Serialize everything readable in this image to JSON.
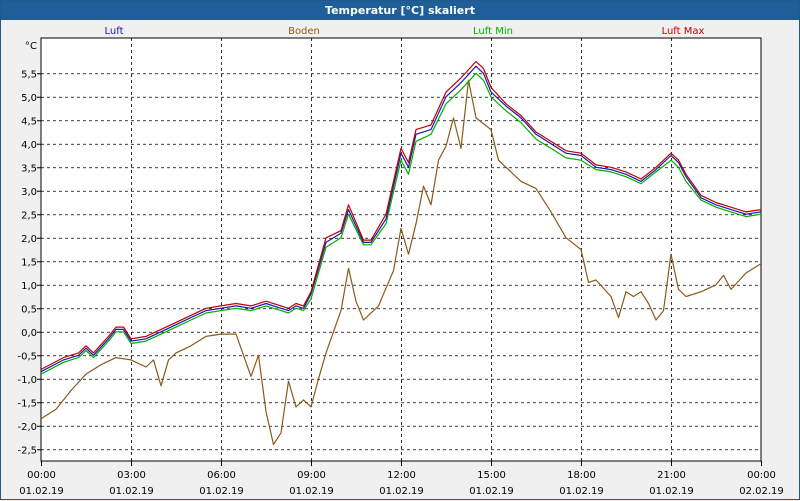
{
  "window": {
    "title": "Temperatur [°C] skaliert"
  },
  "colors": {
    "Luft": "#1a1ab5",
    "Boden": "#8b5a1a",
    "Luft Min": "#00b000",
    "Luft Max": "#c00000"
  },
  "chart_data": {
    "type": "line",
    "title": "Temperatur [°C] skaliert",
    "ylabel": "°C",
    "ylim": [
      -2.75,
      6.25
    ],
    "xlim": [
      "01.02.19 00:00",
      "02.02.19 00:00"
    ],
    "grid": true,
    "legend_placement": "top",
    "yticks": [
      "5,5",
      "5,0",
      "4,5",
      "4,0",
      "3,5",
      "3,0",
      "2,5",
      "2,0",
      "1,5",
      "1,0",
      "0,5",
      "0,0",
      "-0,5",
      "-1,0",
      "-1,5",
      "-2,0",
      "-2,5"
    ],
    "xticks": [
      {
        "time": "00:00",
        "date": "01.02.19"
      },
      {
        "time": "03:00",
        "date": "01.02.19"
      },
      {
        "time": "06:00",
        "date": "01.02.19"
      },
      {
        "time": "09:00",
        "date": "01.02.19"
      },
      {
        "time": "12:00",
        "date": "01.02.19"
      },
      {
        "time": "15:00",
        "date": "01.02.19"
      },
      {
        "time": "18:00",
        "date": "01.02.19"
      },
      {
        "time": "21:00",
        "date": "01.02.19"
      },
      {
        "time": "00:00",
        "date": "02.02.19"
      }
    ],
    "series": [
      {
        "name": "Luft",
        "points": [
          [
            "00:00",
            -0.85
          ],
          [
            "00:45",
            -0.6
          ],
          [
            "01:15",
            -0.5
          ],
          [
            "01:30",
            -0.35
          ],
          [
            "01:45",
            -0.5
          ],
          [
            "02:15",
            -0.15
          ],
          [
            "02:30",
            0.05
          ],
          [
            "02:45",
            0.05
          ],
          [
            "03:00",
            -0.2
          ],
          [
            "03:30",
            -0.15
          ],
          [
            "04:00",
            0.0
          ],
          [
            "04:30",
            0.15
          ],
          [
            "05:00",
            0.3
          ],
          [
            "05:30",
            0.45
          ],
          [
            "06:00",
            0.5
          ],
          [
            "06:30",
            0.55
          ],
          [
            "07:00",
            0.5
          ],
          [
            "07:30",
            0.6
          ],
          [
            "08:00",
            0.5
          ],
          [
            "08:15",
            0.45
          ],
          [
            "08:30",
            0.55
          ],
          [
            "08:45",
            0.5
          ],
          [
            "09:00",
            0.8
          ],
          [
            "09:30",
            1.9
          ],
          [
            "10:00",
            2.1
          ],
          [
            "10:15",
            2.6
          ],
          [
            "10:45",
            1.9
          ],
          [
            "11:00",
            1.9
          ],
          [
            "11:30",
            2.4
          ],
          [
            "12:00",
            3.8
          ],
          [
            "12:15",
            3.5
          ],
          [
            "12:30",
            4.2
          ],
          [
            "13:00",
            4.3
          ],
          [
            "13:30",
            5.0
          ],
          [
            "14:00",
            5.3
          ],
          [
            "14:30",
            5.65
          ],
          [
            "14:45",
            5.5
          ],
          [
            "15:00",
            5.1
          ],
          [
            "15:30",
            4.8
          ],
          [
            "16:00",
            4.55
          ],
          [
            "16:30",
            4.2
          ],
          [
            "17:00",
            4.0
          ],
          [
            "17:30",
            3.8
          ],
          [
            "18:00",
            3.75
          ],
          [
            "18:30",
            3.5
          ],
          [
            "19:00",
            3.45
          ],
          [
            "19:30",
            3.35
          ],
          [
            "20:00",
            3.2
          ],
          [
            "20:30",
            3.45
          ],
          [
            "21:00",
            3.75
          ],
          [
            "21:15",
            3.6
          ],
          [
            "21:30",
            3.3
          ],
          [
            "22:00",
            2.85
          ],
          [
            "22:30",
            2.7
          ],
          [
            "23:00",
            2.6
          ],
          [
            "23:30",
            2.5
          ],
          [
            "24:00",
            2.55
          ]
        ]
      },
      {
        "name": "Boden",
        "points": [
          [
            "00:00",
            -1.85
          ],
          [
            "00:30",
            -1.65
          ],
          [
            "01:00",
            -1.25
          ],
          [
            "01:30",
            -0.9
          ],
          [
            "02:00",
            -0.7
          ],
          [
            "02:30",
            -0.55
          ],
          [
            "03:00",
            -0.6
          ],
          [
            "03:30",
            -0.75
          ],
          [
            "03:45",
            -0.6
          ],
          [
            "04:00",
            -1.15
          ],
          [
            "04:15",
            -0.6
          ],
          [
            "04:30",
            -0.45
          ],
          [
            "05:00",
            -0.3
          ],
          [
            "05:30",
            -0.1
          ],
          [
            "06:00",
            -0.05
          ],
          [
            "06:30",
            -0.05
          ],
          [
            "07:00",
            -0.95
          ],
          [
            "07:15",
            -0.5
          ],
          [
            "07:30",
            -1.7
          ],
          [
            "07:45",
            -2.4
          ],
          [
            "08:00",
            -2.15
          ],
          [
            "08:15",
            -1.05
          ],
          [
            "08:30",
            -1.6
          ],
          [
            "08:45",
            -1.45
          ],
          [
            "09:00",
            -1.6
          ],
          [
            "09:15",
            -1.0
          ],
          [
            "09:30",
            -0.45
          ],
          [
            "10:00",
            0.45
          ],
          [
            "10:15",
            1.35
          ],
          [
            "10:30",
            0.65
          ],
          [
            "10:45",
            0.25
          ],
          [
            "11:15",
            0.55
          ],
          [
            "11:45",
            1.3
          ],
          [
            "12:00",
            2.2
          ],
          [
            "12:15",
            1.65
          ],
          [
            "12:30",
            2.3
          ],
          [
            "12:45",
            3.1
          ],
          [
            "13:00",
            2.7
          ],
          [
            "13:15",
            3.65
          ],
          [
            "13:30",
            3.95
          ],
          [
            "13:45",
            4.55
          ],
          [
            "14:00",
            3.9
          ],
          [
            "14:15",
            5.35
          ],
          [
            "14:30",
            4.55
          ],
          [
            "15:00",
            4.3
          ],
          [
            "15:15",
            3.65
          ],
          [
            "15:30",
            3.5
          ],
          [
            "16:00",
            3.2
          ],
          [
            "16:30",
            3.05
          ],
          [
            "17:00",
            2.55
          ],
          [
            "17:30",
            2.0
          ],
          [
            "18:00",
            1.75
          ],
          [
            "18:15",
            1.05
          ],
          [
            "18:30",
            1.1
          ],
          [
            "19:00",
            0.75
          ],
          [
            "19:15",
            0.3
          ],
          [
            "19:30",
            0.85
          ],
          [
            "19:45",
            0.75
          ],
          [
            "20:00",
            0.85
          ],
          [
            "20:15",
            0.6
          ],
          [
            "20:30",
            0.25
          ],
          [
            "20:45",
            0.45
          ],
          [
            "21:00",
            1.65
          ],
          [
            "21:15",
            0.9
          ],
          [
            "21:30",
            0.75
          ],
          [
            "22:00",
            0.85
          ],
          [
            "22:30",
            1.0
          ],
          [
            "22:45",
            1.2
          ],
          [
            "23:00",
            0.9
          ],
          [
            "23:30",
            1.25
          ],
          [
            "24:00",
            1.45
          ]
        ]
      },
      {
        "name": "Luft Min",
        "points": [
          [
            "00:00",
            -0.9
          ],
          [
            "00:45",
            -0.65
          ],
          [
            "01:15",
            -0.55
          ],
          [
            "01:30",
            -0.4
          ],
          [
            "01:45",
            -0.55
          ],
          [
            "02:15",
            -0.2
          ],
          [
            "02:30",
            0.0
          ],
          [
            "02:45",
            0.0
          ],
          [
            "03:00",
            -0.25
          ],
          [
            "03:30",
            -0.2
          ],
          [
            "04:00",
            -0.05
          ],
          [
            "04:30",
            0.1
          ],
          [
            "05:00",
            0.25
          ],
          [
            "05:30",
            0.4
          ],
          [
            "06:00",
            0.45
          ],
          [
            "06:30",
            0.5
          ],
          [
            "07:00",
            0.45
          ],
          [
            "07:30",
            0.55
          ],
          [
            "08:00",
            0.45
          ],
          [
            "08:15",
            0.4
          ],
          [
            "08:30",
            0.5
          ],
          [
            "08:45",
            0.45
          ],
          [
            "09:00",
            0.7
          ],
          [
            "09:30",
            1.8
          ],
          [
            "10:00",
            2.0
          ],
          [
            "10:15",
            2.5
          ],
          [
            "10:45",
            1.85
          ],
          [
            "11:00",
            1.85
          ],
          [
            "11:30",
            2.3
          ],
          [
            "12:00",
            3.65
          ],
          [
            "12:15",
            3.35
          ],
          [
            "12:30",
            4.05
          ],
          [
            "13:00",
            4.2
          ],
          [
            "13:30",
            4.85
          ],
          [
            "14:00",
            5.15
          ],
          [
            "14:30",
            5.5
          ],
          [
            "14:45",
            5.35
          ],
          [
            "15:00",
            5.0
          ],
          [
            "15:30",
            4.7
          ],
          [
            "16:00",
            4.45
          ],
          [
            "16:30",
            4.1
          ],
          [
            "17:00",
            3.9
          ],
          [
            "17:30",
            3.7
          ],
          [
            "18:00",
            3.65
          ],
          [
            "18:30",
            3.45
          ],
          [
            "19:00",
            3.4
          ],
          [
            "19:30",
            3.3
          ],
          [
            "20:00",
            3.15
          ],
          [
            "20:30",
            3.4
          ],
          [
            "21:00",
            3.65
          ],
          [
            "21:15",
            3.5
          ],
          [
            "21:30",
            3.2
          ],
          [
            "22:00",
            2.8
          ],
          [
            "22:30",
            2.65
          ],
          [
            "23:00",
            2.55
          ],
          [
            "23:30",
            2.45
          ],
          [
            "24:00",
            2.5
          ]
        ]
      },
      {
        "name": "Luft Max",
        "points": [
          [
            "00:00",
            -0.8
          ],
          [
            "00:45",
            -0.55
          ],
          [
            "01:15",
            -0.45
          ],
          [
            "01:30",
            -0.3
          ],
          [
            "01:45",
            -0.45
          ],
          [
            "02:15",
            -0.1
          ],
          [
            "02:30",
            0.1
          ],
          [
            "02:45",
            0.1
          ],
          [
            "03:00",
            -0.15
          ],
          [
            "03:30",
            -0.1
          ],
          [
            "04:00",
            0.05
          ],
          [
            "04:30",
            0.2
          ],
          [
            "05:00",
            0.35
          ],
          [
            "05:30",
            0.5
          ],
          [
            "06:00",
            0.55
          ],
          [
            "06:30",
            0.6
          ],
          [
            "07:00",
            0.55
          ],
          [
            "07:30",
            0.65
          ],
          [
            "08:00",
            0.55
          ],
          [
            "08:15",
            0.5
          ],
          [
            "08:30",
            0.6
          ],
          [
            "08:45",
            0.55
          ],
          [
            "09:00",
            0.85
          ],
          [
            "09:30",
            2.0
          ],
          [
            "10:00",
            2.15
          ],
          [
            "10:15",
            2.7
          ],
          [
            "10:45",
            1.95
          ],
          [
            "11:00",
            1.95
          ],
          [
            "11:30",
            2.5
          ],
          [
            "12:00",
            3.9
          ],
          [
            "12:15",
            3.6
          ],
          [
            "12:30",
            4.3
          ],
          [
            "13:00",
            4.4
          ],
          [
            "13:30",
            5.1
          ],
          [
            "14:00",
            5.4
          ],
          [
            "14:30",
            5.75
          ],
          [
            "14:45",
            5.6
          ],
          [
            "15:00",
            5.2
          ],
          [
            "15:30",
            4.85
          ],
          [
            "16:00",
            4.6
          ],
          [
            "16:30",
            4.25
          ],
          [
            "17:00",
            4.05
          ],
          [
            "17:30",
            3.85
          ],
          [
            "18:00",
            3.8
          ],
          [
            "18:30",
            3.55
          ],
          [
            "19:00",
            3.5
          ],
          [
            "19:30",
            3.4
          ],
          [
            "20:00",
            3.25
          ],
          [
            "20:30",
            3.5
          ],
          [
            "21:00",
            3.8
          ],
          [
            "21:15",
            3.65
          ],
          [
            "21:30",
            3.35
          ],
          [
            "22:00",
            2.9
          ],
          [
            "22:30",
            2.75
          ],
          [
            "23:00",
            2.65
          ],
          [
            "23:30",
            2.55
          ],
          [
            "24:00",
            2.6
          ]
        ]
      }
    ]
  }
}
